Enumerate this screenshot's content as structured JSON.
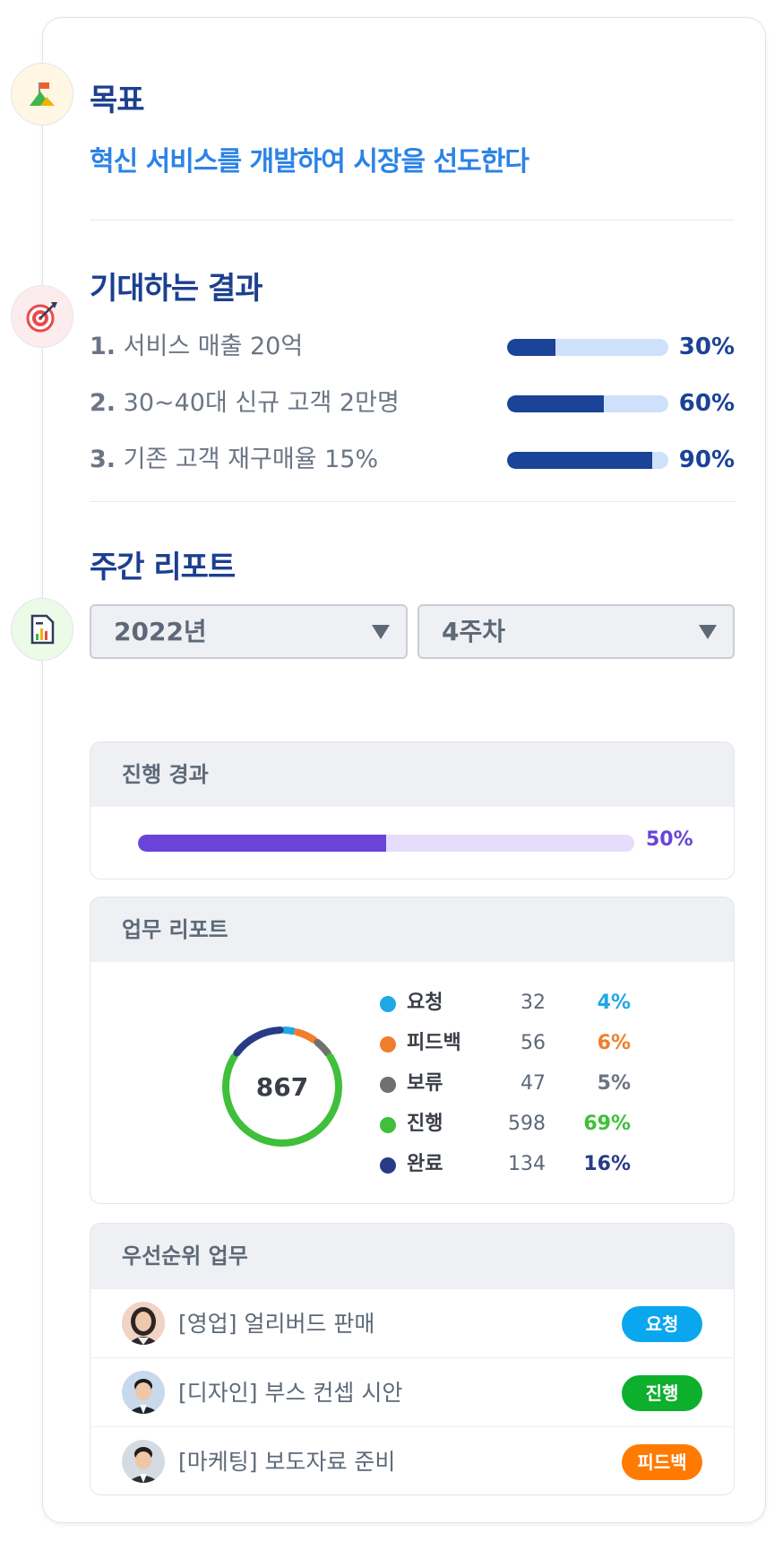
{
  "goal": {
    "title": "목표",
    "text": "혁신 서비스를 개발하여 시장을 선도한다"
  },
  "results": {
    "title": "기대하는 결과",
    "items": [
      {
        "num": "1.",
        "label": "서비스 매출 20억",
        "percent": 30,
        "percent_label": "30%"
      },
      {
        "num": "2.",
        "label": "30~40대 신규 고객 2만명",
        "percent": 60,
        "percent_label": "60%"
      },
      {
        "num": "3.",
        "label": "기존 고객 재구매율 15%",
        "percent": 90,
        "percent_label": "90%"
      }
    ]
  },
  "weekly": {
    "title": "주간 리포트",
    "year_select": "2022년",
    "week_select": "4주차"
  },
  "progress": {
    "title": "진행 경과",
    "percent": 50,
    "percent_label": "50%"
  },
  "task_report": {
    "title": "업무 리포트",
    "total": "867",
    "legend": [
      {
        "name": "요청",
        "count": "32",
        "pct": "4%",
        "color": "#1fa8e6"
      },
      {
        "name": "피드백",
        "count": "56",
        "pct": "6%",
        "color": "#f07e2c"
      },
      {
        "name": "보류",
        "count": "47",
        "pct": "5%",
        "color": "#707070"
      },
      {
        "name": "진행",
        "count": "598",
        "pct": "69%",
        "color": "#3fbf3a"
      },
      {
        "name": "완료",
        "count": "134",
        "pct": "16%",
        "color": "#283c85"
      }
    ]
  },
  "priority": {
    "title": "우선순위 업무",
    "items": [
      {
        "text": "[영업] 얼리버드 판매",
        "badge": "요청",
        "badge_color": "#0aa7ef"
      },
      {
        "text": "[디자인] 부스 컨셉 시안",
        "badge": "진행",
        "badge_color": "#0cb02c"
      },
      {
        "text": "[마케팅] 보도자료 준비",
        "badge": "피드백",
        "badge_color": "#ff7a00"
      }
    ]
  },
  "colors": {
    "accent_blue": "#1b4397",
    "bar_track": "#cfe0fb",
    "progress_purple": "#6a44d9",
    "progress_track": "#e6dcfb"
  }
}
